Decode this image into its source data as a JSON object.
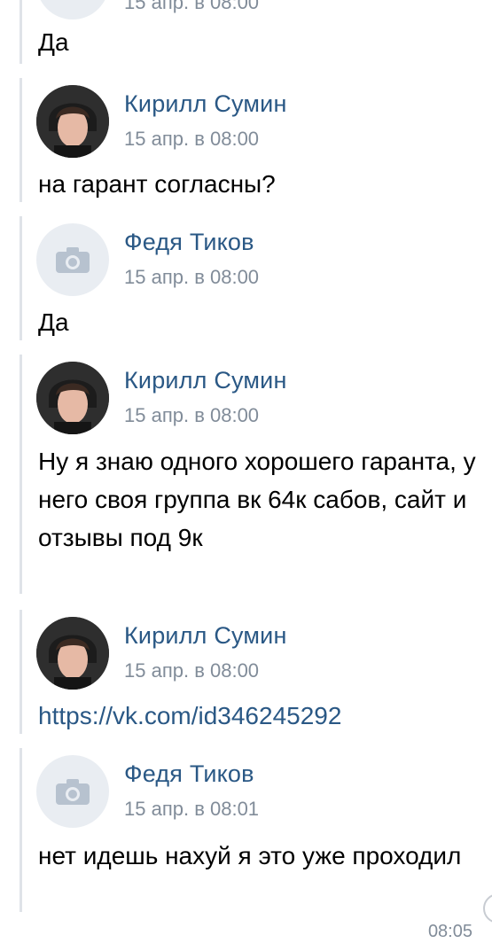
{
  "prev": {
    "date": "15 апр. в 08:00",
    "text": "Да"
  },
  "messages": [
    {
      "author": "Кирилл Сумин",
      "avatar": "photo",
      "date": "15 апр. в 08:00",
      "text": "на гарант согласны?"
    },
    {
      "author": "Федя Тиков",
      "avatar": "camera-placeholder-icon",
      "date": "15 апр. в 08:00",
      "text": "Да"
    },
    {
      "author": "Кирилл Сумин",
      "avatar": "photo",
      "date": "15 апр. в 08:00",
      "text": "Ну я знаю одного хорошего гаранта, у него своя группа вк 64к сабов, сайт и отзывы под 9к"
    },
    {
      "author": "Кирилл Сумин",
      "avatar": "photo",
      "date": "15 апр. в 08:00",
      "text": "https://vk.com/id346245292"
    },
    {
      "author": "Федя Тиков",
      "avatar": "camera-placeholder-icon",
      "date": "15 апр. в 08:01",
      "text": "нет идешь нахуй я это уже проходил"
    }
  ],
  "footer_time": "08:05",
  "colors": {
    "author": "#2a5885",
    "meta": "#818c99",
    "link": "#2a5885",
    "rail": "#dfe3e8"
  }
}
